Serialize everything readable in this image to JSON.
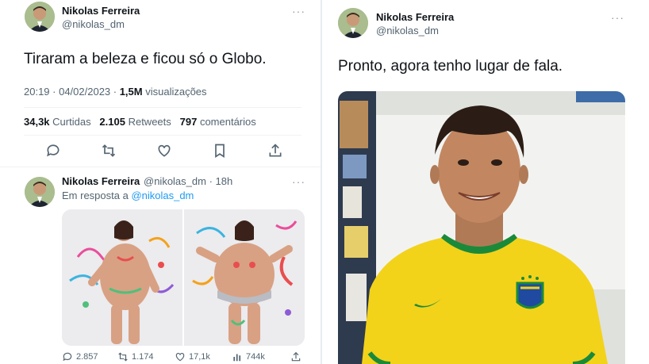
{
  "left_tweet": {
    "author_name": "Nikolas Ferreira",
    "author_handle": "@nikolas_dm",
    "more": "···",
    "text": "Tiraram a beleza e ficou só o Globo.",
    "timestamp": "20:19 · 04/02/2023 · ",
    "views_count": "1,5M",
    "views_label": " visualizações",
    "likes_count": "34,3k",
    "likes_label": " Curtidas",
    "retweets_count": "2.105",
    "retweets_label": " Retweets",
    "comments_count": "797",
    "comments_label": " comentários",
    "actions": [
      "reply-icon",
      "retweet-icon",
      "like-icon",
      "bookmark-icon",
      "share-icon"
    ]
  },
  "reply_tweet": {
    "author_name": "Nikolas Ferreira",
    "author_handle": "@nikolas_dm · 18h",
    "reply_prefix": "Em resposta a ",
    "reply_target": "@nikolas_dm",
    "more": "···",
    "replies": "2.857",
    "retweets": "1.174",
    "likes": "17,1k",
    "views": "744k"
  },
  "right_tweet": {
    "author_name": "Nikolas Ferreira",
    "author_handle": "@nikolas_dm",
    "more": "···",
    "text": "Pronto, agora tenho lugar de fala."
  },
  "colors": {
    "accent": "#1d9bf0",
    "muted": "#536471",
    "text": "#0f1419",
    "jersey": "#f3d21a",
    "jersey_trim": "#1a8a3a"
  }
}
